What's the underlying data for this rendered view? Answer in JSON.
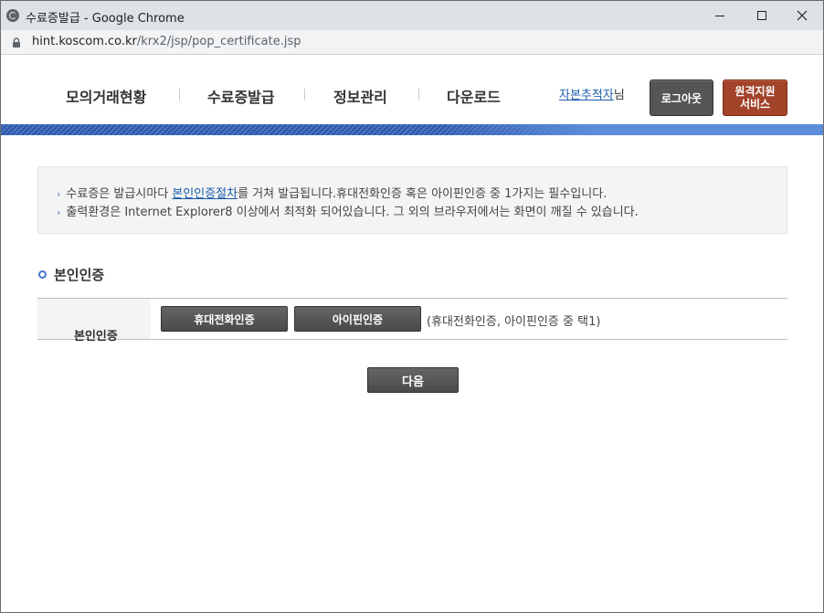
{
  "window": {
    "title": "수료증발급 - Google Chrome",
    "url_host": "hint.koscom.co.kr",
    "url_path": "/krx2/jsp/pop_certificate.jsp"
  },
  "header": {
    "nav": [
      "모의거래현황",
      "수료증발급",
      "정보관리",
      "다운로드"
    ],
    "user_name": "자본추적자",
    "user_suffix": "님",
    "logout_label": "로그아웃",
    "remote_label_1": "원격지원",
    "remote_label_2": "서비스"
  },
  "notice": {
    "line1_prefix": "수료증은 발급시마다 ",
    "line1_link": "본인인증절차",
    "line1_suffix": "를 거쳐 발급됩니다.휴대전화인증 혹은 아이핀인증 중 1가지는 필수입니다.",
    "line2": "출력환경은 Internet Explorer8 이상에서 최적화 되어있습니다. 그 외의 브라우저에서는 화면이 깨질 수 있습니다."
  },
  "section": {
    "title": "본인인증",
    "row_label": "본인인증",
    "phone_button": "휴대전화인증",
    "ipin_button": "아이핀인증",
    "note": "(휴대전화인증, 아이핀인증 중 택1)"
  },
  "next_button": "다음",
  "icons": {
    "favicon": "globe-icon",
    "lock": "lock-icon",
    "bullet": "chevron-right-icon",
    "section": "circle-icon"
  },
  "colors": {
    "accent_blue": "#2f57a3",
    "remote_button": "#a2432a",
    "dark_button": "#555555",
    "link": "#1c5cab"
  }
}
